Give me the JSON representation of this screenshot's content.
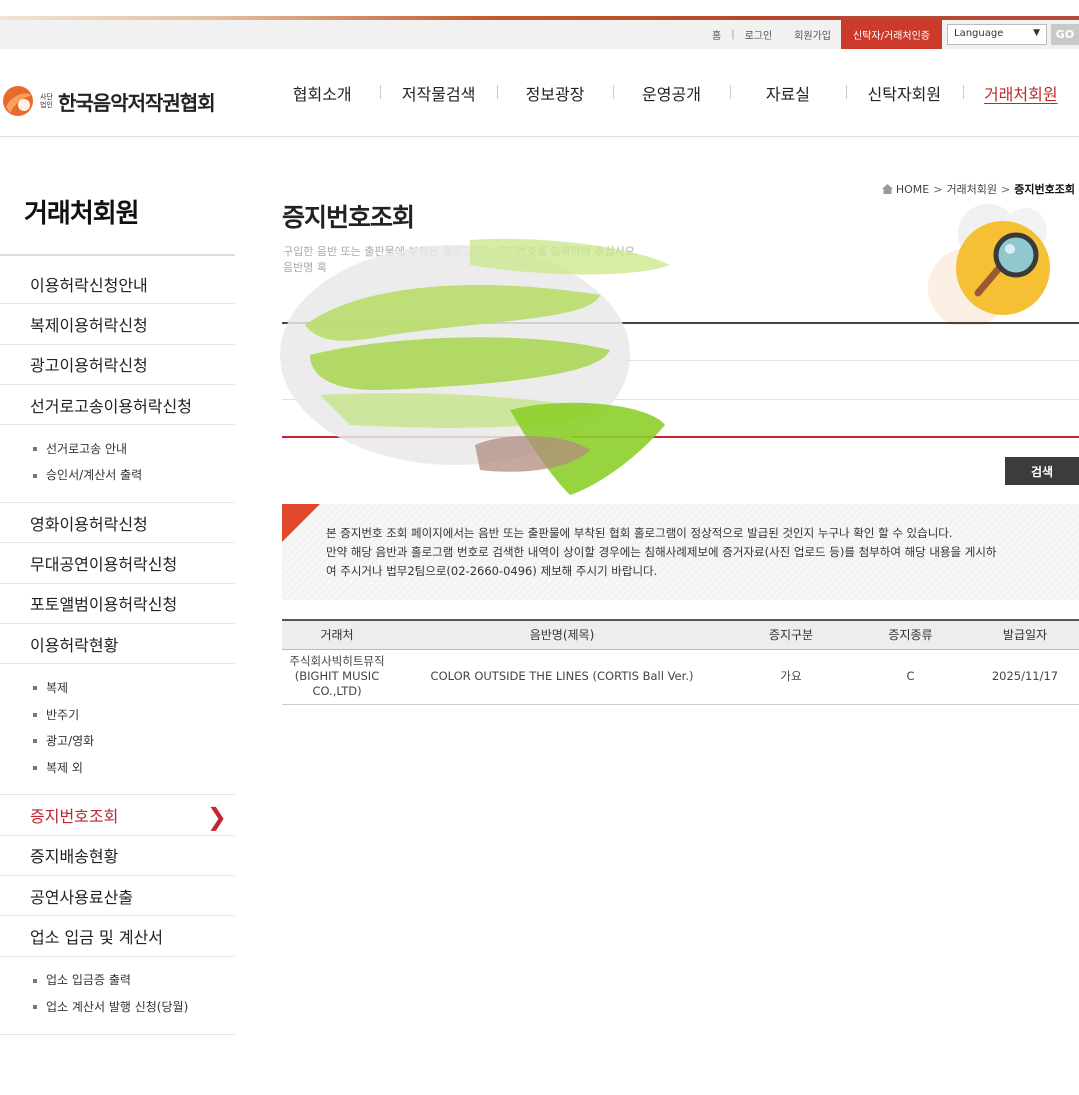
{
  "util": {
    "links": [
      "홈",
      "로그인",
      "회원가입"
    ],
    "trust_button": "신탁자/거래처인증",
    "language": "Language",
    "go": "GO"
  },
  "logo": {
    "sub": "사단 법인",
    "text": "한국음악저작권협회"
  },
  "gnb": [
    "협회소개",
    "저작물검색",
    "정보광장",
    "운영공개",
    "자료실",
    "신탁자회원",
    "거래처회원"
  ],
  "sidebar": {
    "title": "거래처회원",
    "items_a": [
      "이용허락신청안내",
      "복제이용허락신청",
      "광고이용허락신청",
      "선거로고송이용허락신청"
    ],
    "sub_a": [
      "선거로고송 안내",
      "승인서/계산서 출력"
    ],
    "items_b": [
      "영화이용허락신청",
      "무대공연이용허락신청",
      "포토앨범이용허락신청",
      "이용허락현황"
    ],
    "sub_b": [
      "복제",
      "반주기",
      "광고/영화",
      "복제 외"
    ],
    "items_c": [
      "증지번호조회",
      "증지배송현황",
      "공연사용료산출",
      "업소 입금 및 계산서"
    ],
    "sub_c": [
      "업소 입금증 출력",
      "업소 계산서 발행 신청(당월)"
    ]
  },
  "breadcrumb": {
    "home": "HOME",
    "mid": "거래처회원",
    "current": "증지번호조회"
  },
  "page": {
    "title": "증지번호조회",
    "desc_line1": "구입한 음반 또는 출판물에 부착된 홀로그램의 증지번호를 입력하여 주십시오.",
    "desc_line2": "음반명 혹"
  },
  "search_button": "검색",
  "notice": {
    "line1": "본 증지번호 조회 페이지에서는 음반 또는 출판물에 부착된 협회 홀로그램이 정상적으로 발급된 것인지 누구나 확인 할 수 있습니다.",
    "line2": "만약 해당 음반과 홀로그램 번호로 검색한 내역이 상이할 경우에는 침해사례제보에 증거자료(사진 업로드 등)를 첨부하여 해당 내용을 게시하",
    "line3": "여 주시거나 법무2팀으로(02-2660-0496) 제보해 주시기 바랍니다."
  },
  "table": {
    "headers": [
      "거래처",
      "음반명(제목)",
      "증지구분",
      "증지종류",
      "발급일자"
    ],
    "row": {
      "vendor_l1": "주식회사빅히트뮤직",
      "vendor_l2": "(BIGHIT MUSIC",
      "vendor_l3": "CO.,LTD)",
      "album": "COLOR OUTSIDE THE LINES (CORTIS Ball Ver.)",
      "category": "가요",
      "type": "C",
      "date": "2025/11/17"
    }
  },
  "colors": {
    "accent": "#c0282d",
    "trust_bg": "#cc3a2c",
    "badge": "#f6c035"
  }
}
